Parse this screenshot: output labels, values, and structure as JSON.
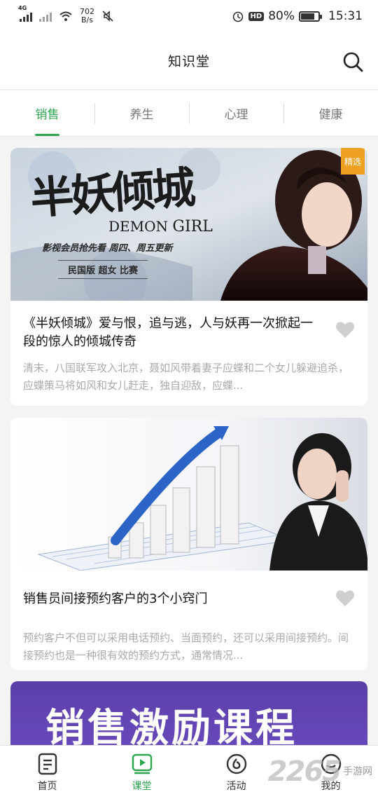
{
  "status_bar": {
    "network_label": "4G",
    "net_speed_value": "702",
    "net_speed_unit": "B/s",
    "battery_percent": "80%",
    "battery_level": 0.8,
    "time": "15:31",
    "hd_label": "HD"
  },
  "header": {
    "title": "知识堂"
  },
  "tabs": [
    {
      "label": "销售",
      "active": true
    },
    {
      "label": "养生",
      "active": false
    },
    {
      "label": "心理",
      "active": false
    },
    {
      "label": "健康",
      "active": false
    }
  ],
  "articles": [
    {
      "badge": "精选",
      "image_title": "半妖倾城",
      "image_subtitle_en_1": "DEMON",
      "image_subtitle_en_2": "GIRL",
      "image_tagline": "影视会员抢先看  周四、周五更新",
      "image_banner": "民国版 超女 比赛",
      "title": "《半妖倾城》爱与恨，追与逃，人与妖再一次掀起一段的惊人的倾城传奇",
      "desc": "清末，八国联军攻入北京，聂如风带着妻子应蝶和二个女儿躲避追杀，应蝶策马将如风和女儿赶走，独自迎敌，应蝶..."
    },
    {
      "title": "销售员间接预约客户的3个小窍门",
      "desc": "预约客户不但可以采用电话预约、当面预约，还可以采用间接预约。间接预约也是一种很有效的预约方式，通常情况..."
    },
    {
      "image_text": "销售激励课程"
    }
  ],
  "bottom_nav": [
    {
      "label": "首页",
      "icon": "home-doc-icon",
      "active": false
    },
    {
      "label": "课堂",
      "icon": "classroom-play-icon",
      "active": true
    },
    {
      "label": "活动",
      "icon": "activity-icon",
      "active": false
    },
    {
      "label": "我的",
      "icon": "profile-icon",
      "active": false
    }
  ],
  "watermark": {
    "number": "2265",
    "text_1": "手游网",
    "text_2": ""
  },
  "colors": {
    "accent": "#2da44e",
    "badge": "#f0a020",
    "banner3_bg": "#5a3fa8"
  }
}
